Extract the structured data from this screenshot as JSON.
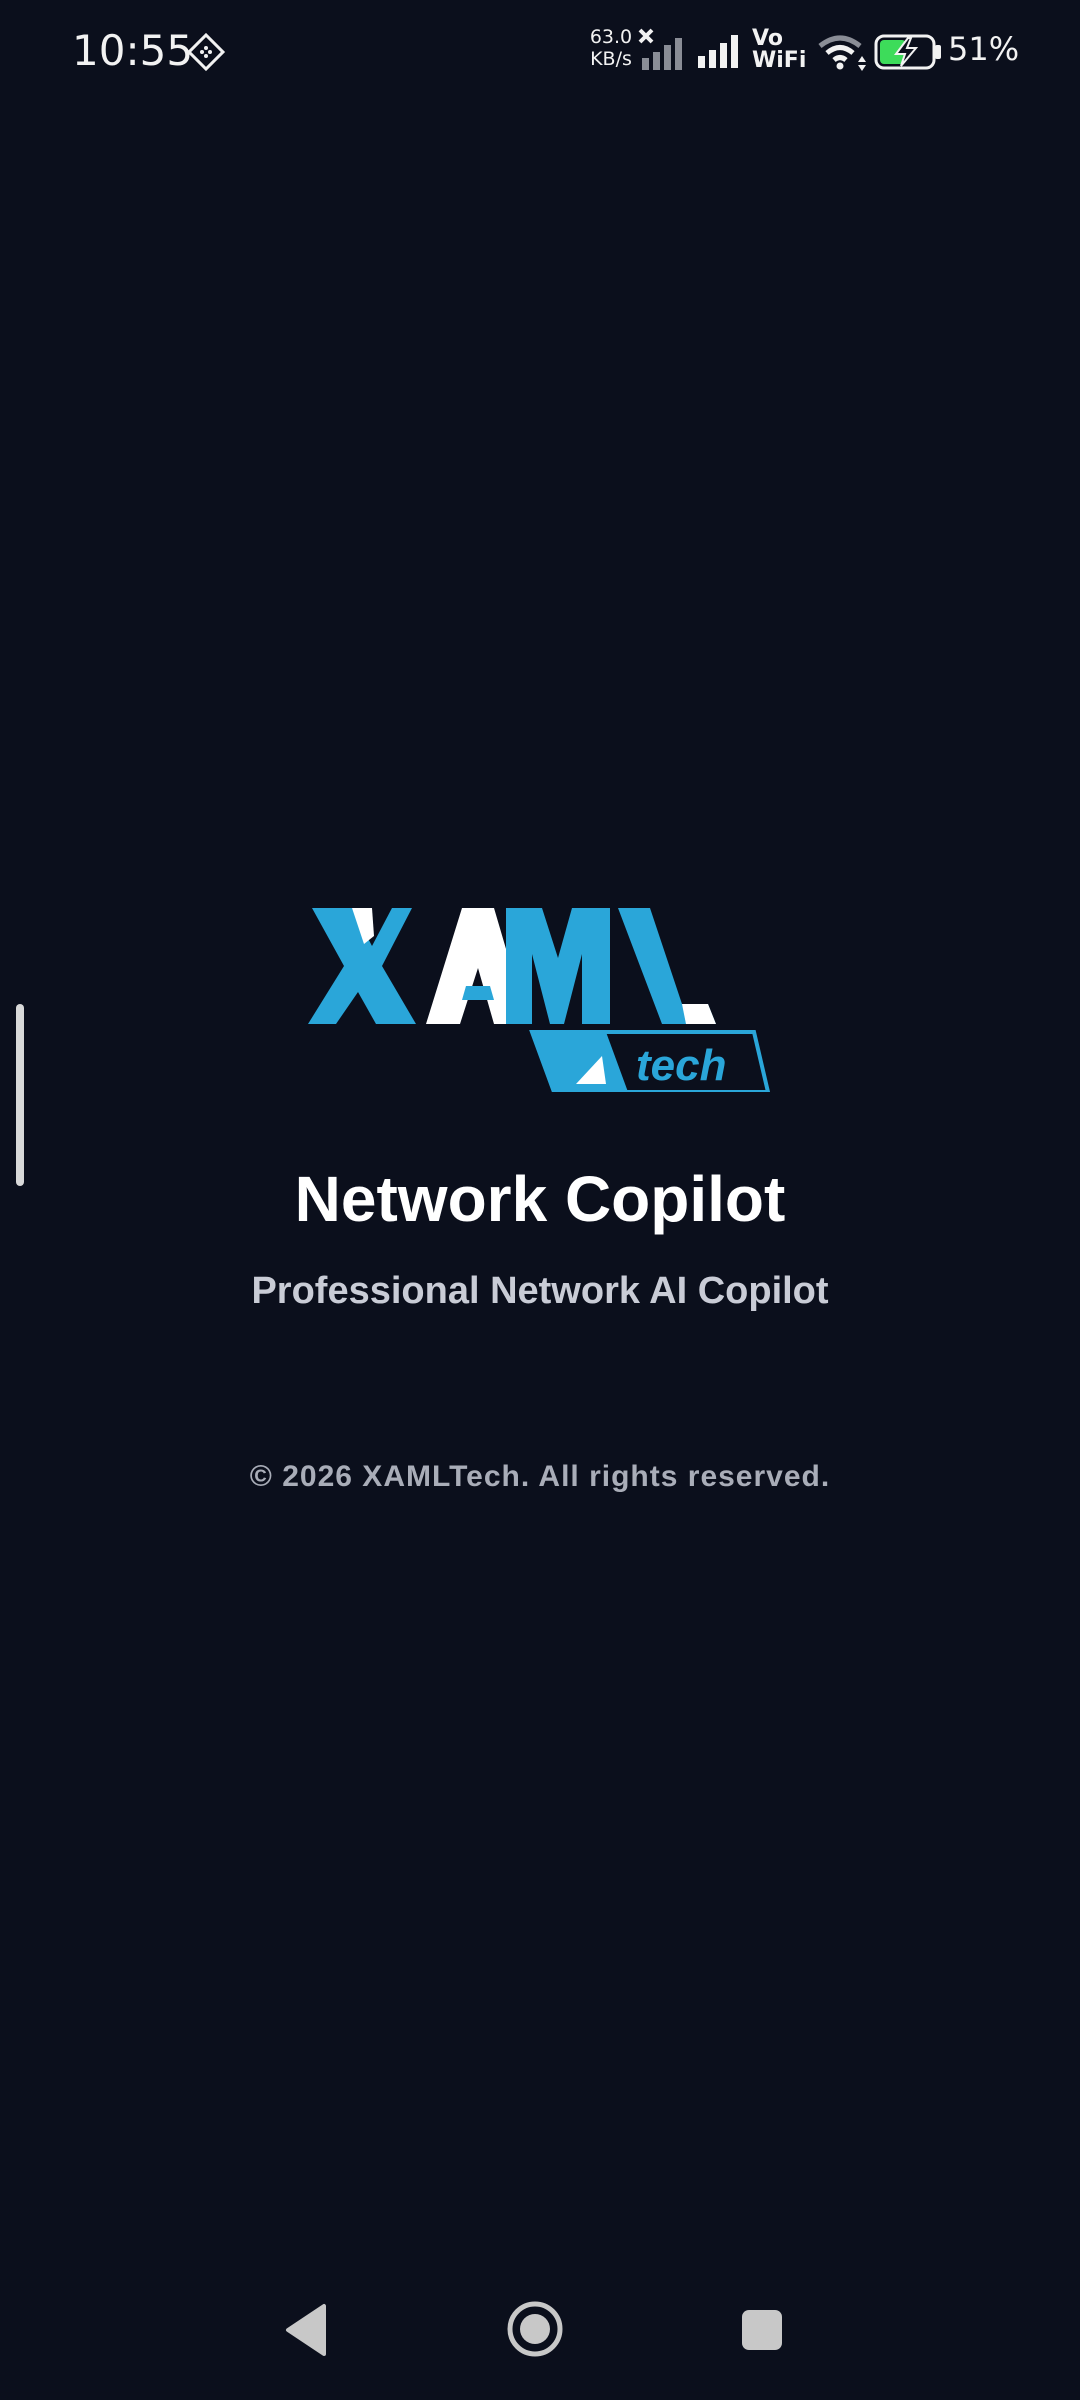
{
  "status_bar": {
    "time": "10:55",
    "net_speed_value": "63.0",
    "net_speed_unit": "KB/s",
    "vowifi_top": "Vo",
    "vowifi_bottom": "WiFi",
    "battery_percent": "51%",
    "icons": [
      "notification-diamond-icon",
      "no-signal-icon",
      "signal-icon",
      "wifi-icon",
      "battery-charging-icon"
    ]
  },
  "logo": {
    "brand_top": "XAML",
    "brand_bottom": "tech",
    "colors": {
      "blue": "#2aa6d9",
      "white": "#ffffff"
    }
  },
  "app": {
    "title": "Network Copilot",
    "subtitle": "Professional Network AI Copilot",
    "copyright": "© 2026 XAMLTech. All rights reserved."
  },
  "nav_bar": {
    "icons": [
      "back-icon",
      "home-icon",
      "recents-icon"
    ]
  },
  "colors": {
    "background": "#0b0f1c",
    "accent": "#2aa6d9",
    "battery_green": "#3ddc5a"
  }
}
